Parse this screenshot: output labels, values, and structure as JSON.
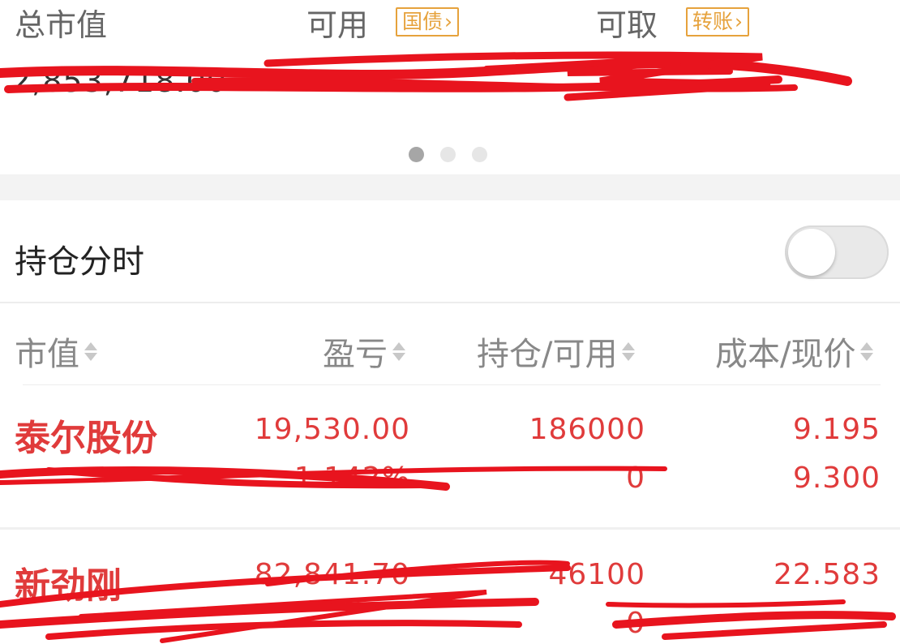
{
  "summary": {
    "total_market_value": {
      "label": "总市值",
      "value": "2,853,718.00"
    },
    "available": {
      "label": "可用",
      "value": ""
    },
    "withdrawable": {
      "label": "可取",
      "value": ""
    },
    "treasury_button": "国债",
    "transfer_button": "转账",
    "page_indicator": {
      "count": 3,
      "active": 1
    }
  },
  "holdings": {
    "title": "持仓分时",
    "toggle_on": false,
    "columns": [
      "市值",
      "盈亏",
      "持仓/可用",
      "成本/现价"
    ],
    "rows": [
      {
        "name": "泰尔股份",
        "market_value": "",
        "profit": "19,530.00",
        "profit_pct": "1.142%",
        "position": "186000",
        "available": "0",
        "cost": "9.195",
        "price": "9.300"
      },
      {
        "name": "新劲刚",
        "market_value": "",
        "profit": "82,841.70",
        "profit_pct": "",
        "position": "46100",
        "available": "0",
        "cost": "22.583",
        "price": ""
      }
    ]
  },
  "colors": {
    "accent": "#e6a23c",
    "profit_red": "#e03b3b",
    "redaction": "#e8141e"
  },
  "icons": {
    "chevron": "chevron-right-icon",
    "sort": "sort-arrows-icon"
  }
}
